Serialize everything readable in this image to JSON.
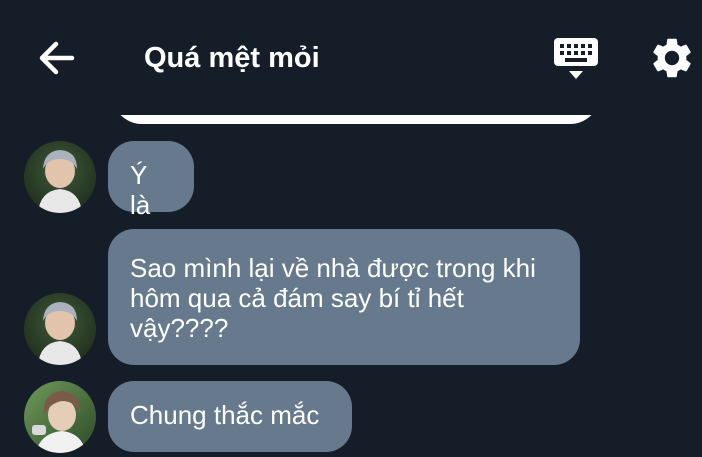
{
  "header": {
    "title": "Quá mệt mỏi"
  },
  "icons": {
    "back": "arrow-left-icon",
    "keyboard": "keyboard-icon",
    "settings": "gear-icon"
  },
  "messages": [
    {
      "sender": "avatar-1",
      "text": "Ý là"
    },
    {
      "sender": "avatar-1",
      "text": "Sao mình lại về nhà được trong khi\nhôm qua cả đám say bí tỉ hết\nvậy????"
    },
    {
      "sender": "avatar-2",
      "text": "Chung thắc mắc"
    }
  ],
  "colors": {
    "background": "#141d28",
    "bubble": "#677a8d",
    "text": "#ffffff"
  }
}
